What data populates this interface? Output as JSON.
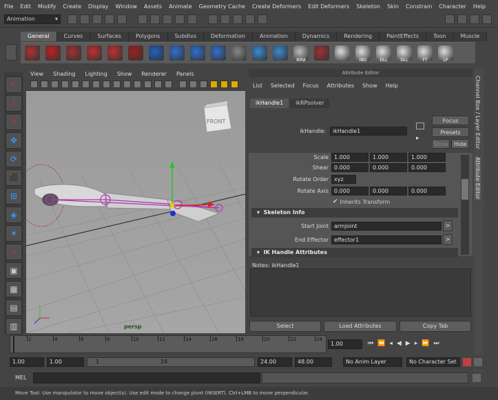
{
  "menu": [
    "File",
    "Edit",
    "Modify",
    "Create",
    "Display",
    "Window",
    "Assets",
    "Animate",
    "Geometry Cache",
    "Create Deformers",
    "Edit Deformers",
    "Skeleton",
    "Skin",
    "Constrain",
    "Character",
    "Help"
  ],
  "mode": "Animation",
  "shelf_tabs": [
    "General",
    "Curves",
    "Surfaces",
    "Polygons",
    "Subdivs",
    "Deformation",
    "Animation",
    "Dynamics",
    "Rendering",
    "PaintEffects",
    "Toon",
    "Muscle"
  ],
  "shelf_labels": [
    "IKRA",
    "",
    "",
    "IBD",
    "DLL",
    "DLL",
    "FT",
    "LP"
  ],
  "viewport": {
    "menu": [
      "View",
      "Shading",
      "Lighting",
      "Show",
      "Renderer",
      "Panels"
    ],
    "camera_label": "persp",
    "viewcube_label": "FRONT"
  },
  "attribute_editor": {
    "title": "Attribute Editor",
    "menu": [
      "List",
      "Selected",
      "Focus",
      "Attributes",
      "Show",
      "Help"
    ],
    "tabs": [
      "ikHandle1",
      "ikRPsolver"
    ],
    "node_label": "ikHandle:",
    "node_name": "ikHandle1",
    "buttons": {
      "focus": "Focus",
      "presets": "Presets",
      "show": "Show",
      "hide": "Hide"
    },
    "rows": {
      "scale": {
        "label": "Scale",
        "values": [
          "1.000",
          "1.000",
          "1.000"
        ]
      },
      "shear": {
        "label": "Shear",
        "values": [
          "0.000",
          "0.000",
          "0.000"
        ]
      },
      "rotate_order": {
        "label": "Rotate Order",
        "value": "xyz"
      },
      "rotate_axis": {
        "label": "Rotate Axis",
        "values": [
          "0.000",
          "0.000",
          "0.000"
        ]
      },
      "inherits": "Inherits Transform"
    },
    "skeleton_info": {
      "header": "Skeleton Info",
      "start_joint_label": "Start Joint",
      "start_joint": "armJoint",
      "end_effector_label": "End Effector",
      "end_effector": "effector1"
    },
    "ik_header": "IK Handle Attributes",
    "notes_label": "Notes: ikHandle1",
    "bottom_buttons": [
      "Select",
      "Load Attributes",
      "Copy Tab"
    ]
  },
  "side_tabs": [
    "Channel Box / Layer Editor",
    "Attribute Editor"
  ],
  "timeline": {
    "ticks": [
      "2",
      "4",
      "6",
      "8",
      "10",
      "12",
      "14",
      "16",
      "18",
      "20",
      "22",
      "24"
    ],
    "current_frame": "1.00"
  },
  "range": {
    "start": "1.00",
    "start2": "1.00",
    "slider_start": "1",
    "slider_end": "24",
    "end": "24.00",
    "end2": "48.00",
    "anim_layer": "No Anim Layer",
    "char_set": "No Character Set"
  },
  "mel_label": "MEL",
  "help_line": "Move Tool: Use manipulator to move object(s). Use edit mode to change pivot (INSERT). Ctrl+LMB to move perpendicular.",
  "colors": {
    "accent": "#b038b0",
    "manip_green": "#2fc02f",
    "manip_red": "#e02020",
    "manip_blue": "#2030d0"
  }
}
